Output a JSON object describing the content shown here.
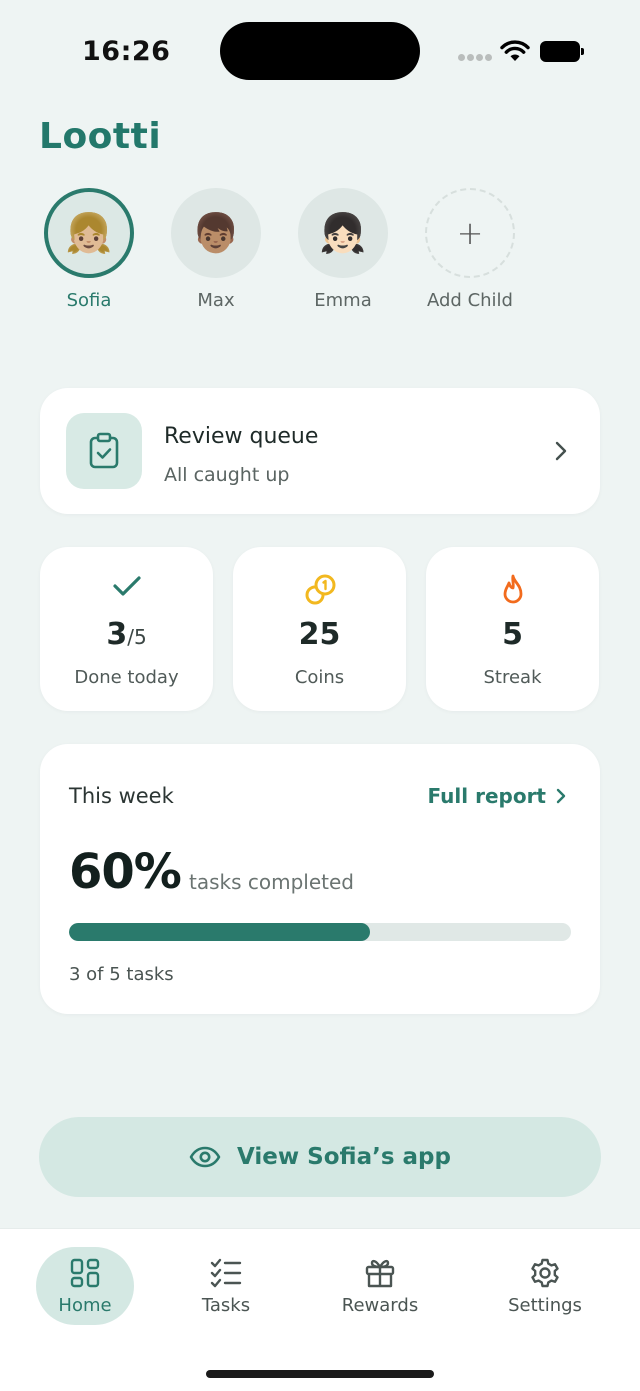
{
  "status_bar": {
    "time": "16:26"
  },
  "app": {
    "title": "Lootti"
  },
  "children": [
    {
      "name": "Sofia",
      "avatar": "👧🏼",
      "selected": true
    },
    {
      "name": "Max",
      "avatar": "👦🏽",
      "selected": false
    },
    {
      "name": "Emma",
      "avatar": "👧🏻",
      "selected": false
    },
    {
      "name": "Add Child",
      "avatar": "+",
      "selected": false
    }
  ],
  "review": {
    "title": "Review queue",
    "subtitle": "All caught up"
  },
  "stats": {
    "done": {
      "value": "3",
      "total": "/5",
      "label": "Done today"
    },
    "coins": {
      "value": "25",
      "label": "Coins"
    },
    "streak": {
      "value": "5",
      "label": "Streak"
    }
  },
  "week": {
    "title": "This week",
    "report_link": "Full report",
    "percent_text": "60%",
    "percent_label": "tasks completed",
    "progress": 0.6,
    "tasks_text": "3 of 5 tasks"
  },
  "view_app_button": "View Sofia’s app",
  "tabs": [
    {
      "label": "Home",
      "icon": "grid-icon",
      "active": true
    },
    {
      "label": "Tasks",
      "icon": "checklist-icon",
      "active": false
    },
    {
      "label": "Rewards",
      "icon": "gift-icon",
      "active": false
    },
    {
      "label": "Settings",
      "icon": "gear-icon",
      "active": false
    }
  ],
  "colors": {
    "accent": "#2A7A6C",
    "background": "#EEF4F3",
    "coin": "#F2B81F",
    "streak": "#F26B1D"
  }
}
